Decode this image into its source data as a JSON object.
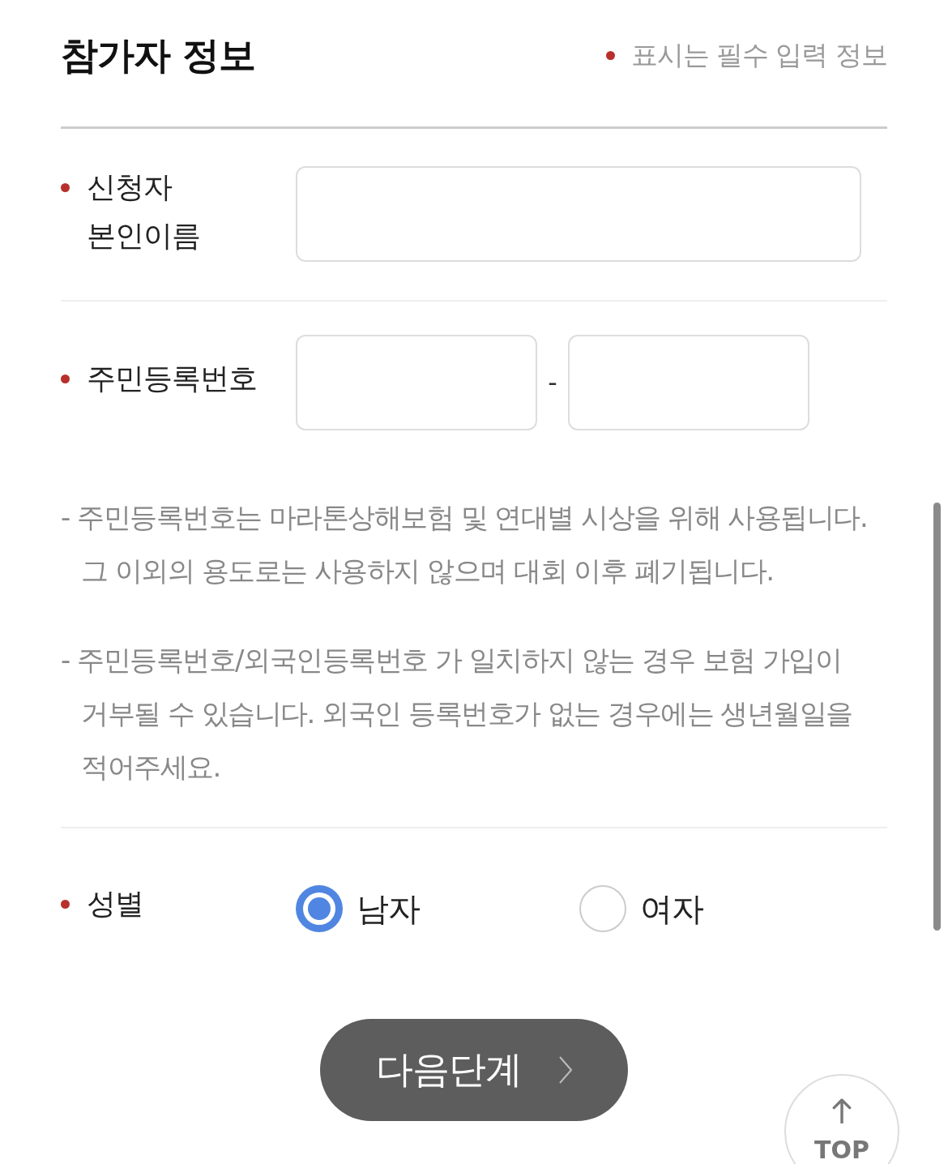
{
  "header": {
    "title": "참가자 정보",
    "legend": "표시는 필수 입력 정보"
  },
  "fields": [
    {
      "kind": "text",
      "label": "신청자 본인이름",
      "required": true
    },
    {
      "kind": "split",
      "label": "주민등록번호",
      "required": true,
      "separator": "-",
      "notes": [
        "- 주민등록번호는 마라톤상해보험 및 연대별 시상을 위해 사용됩니다. 그 이외의 용도로는 사용하지 않으며 대회 이후 폐기됩니다.",
        "- 주민등록번호/외국인등록번호 가 일치하지 않는 경우 보험 가입이 거부될 수 있습니다. 외국인 등록번호가 없는 경우에는 생년월일을 적어주세요."
      ]
    },
    {
      "kind": "radio",
      "label": "성별",
      "required": true,
      "options": [
        {
          "label": "남자",
          "selected": true
        },
        {
          "label": "여자",
          "selected": false
        }
      ]
    }
  ],
  "next_button": {
    "label": "다음단계"
  },
  "top_button": {
    "label": "TOP"
  }
}
